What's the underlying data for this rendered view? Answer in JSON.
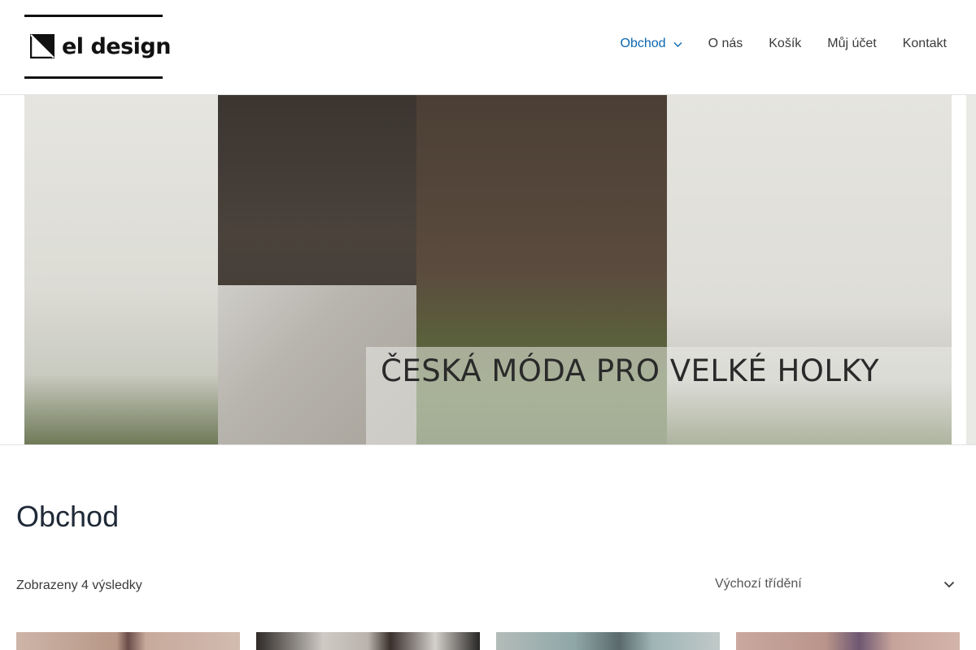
{
  "header": {
    "logo": {
      "text": "el design"
    },
    "nav": [
      {
        "label": "Obchod",
        "active": true,
        "has_dropdown": true
      },
      {
        "label": "O nás",
        "active": false,
        "has_dropdown": false
      },
      {
        "label": "Košík",
        "active": false,
        "has_dropdown": false
      },
      {
        "label": "Můj účet",
        "active": false,
        "has_dropdown": false
      },
      {
        "label": "Kontakt",
        "active": false,
        "has_dropdown": false
      }
    ]
  },
  "banner": {
    "caption": "ČESKÁ MÓDA PRO VELKÉ HOLKY"
  },
  "shop": {
    "title": "Obchod",
    "result_count": "Zobrazeny 4 výsledky",
    "orderby": {
      "selected": "Výchozí třídění",
      "icon": "chevron-down-icon"
    }
  },
  "products": [
    {
      "id": "product-1"
    },
    {
      "id": "product-2"
    },
    {
      "id": "product-3"
    },
    {
      "id": "product-4"
    }
  ],
  "colors": {
    "nav_active": "#0a66b0",
    "text": "#3a3a3a",
    "title": "#1f2937",
    "border": "#e2e2e2"
  }
}
